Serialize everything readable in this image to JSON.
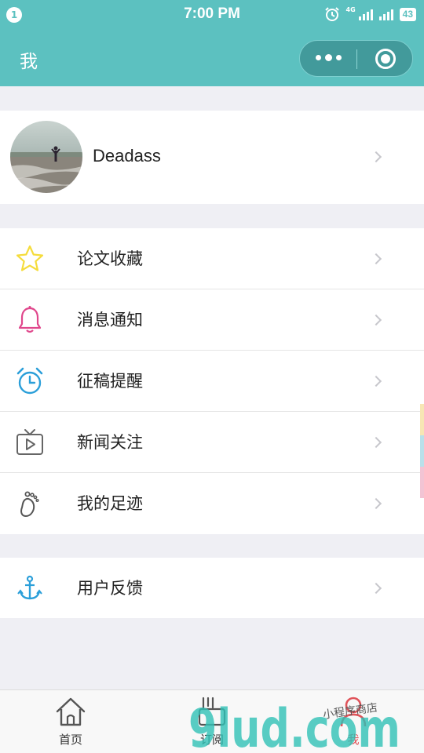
{
  "status_bar": {
    "notification_count": "1",
    "time": "7:00 PM",
    "network": "4G",
    "battery": "43"
  },
  "nav": {
    "title": "我"
  },
  "profile": {
    "name": "Deadass"
  },
  "menu": [
    {
      "label": "论文收藏",
      "icon": "star-icon",
      "color": "#f5dc3c"
    },
    {
      "label": "消息通知",
      "icon": "bell-icon",
      "color": "#e0478c"
    },
    {
      "label": "征稿提醒",
      "icon": "alarm-clock-icon",
      "color": "#2b9fd9"
    },
    {
      "label": "新闻关注",
      "icon": "tv-icon",
      "color": "#666666"
    },
    {
      "label": "我的足迹",
      "icon": "footprint-icon",
      "color": "#555555"
    }
  ],
  "feedback": {
    "label": "用户反馈",
    "icon": "anchor-icon",
    "color": "#2b9fd9"
  },
  "tabs": [
    {
      "label": "首页",
      "icon": "home-icon"
    },
    {
      "label": "订阅",
      "icon": "subscribe-icon"
    },
    {
      "label": "我",
      "icon": "user-icon"
    }
  ],
  "watermark": {
    "text": "9lud.com",
    "caption": "小程序商店"
  },
  "colors": {
    "accent": "#5cc1c0",
    "background": "#efeff4"
  }
}
